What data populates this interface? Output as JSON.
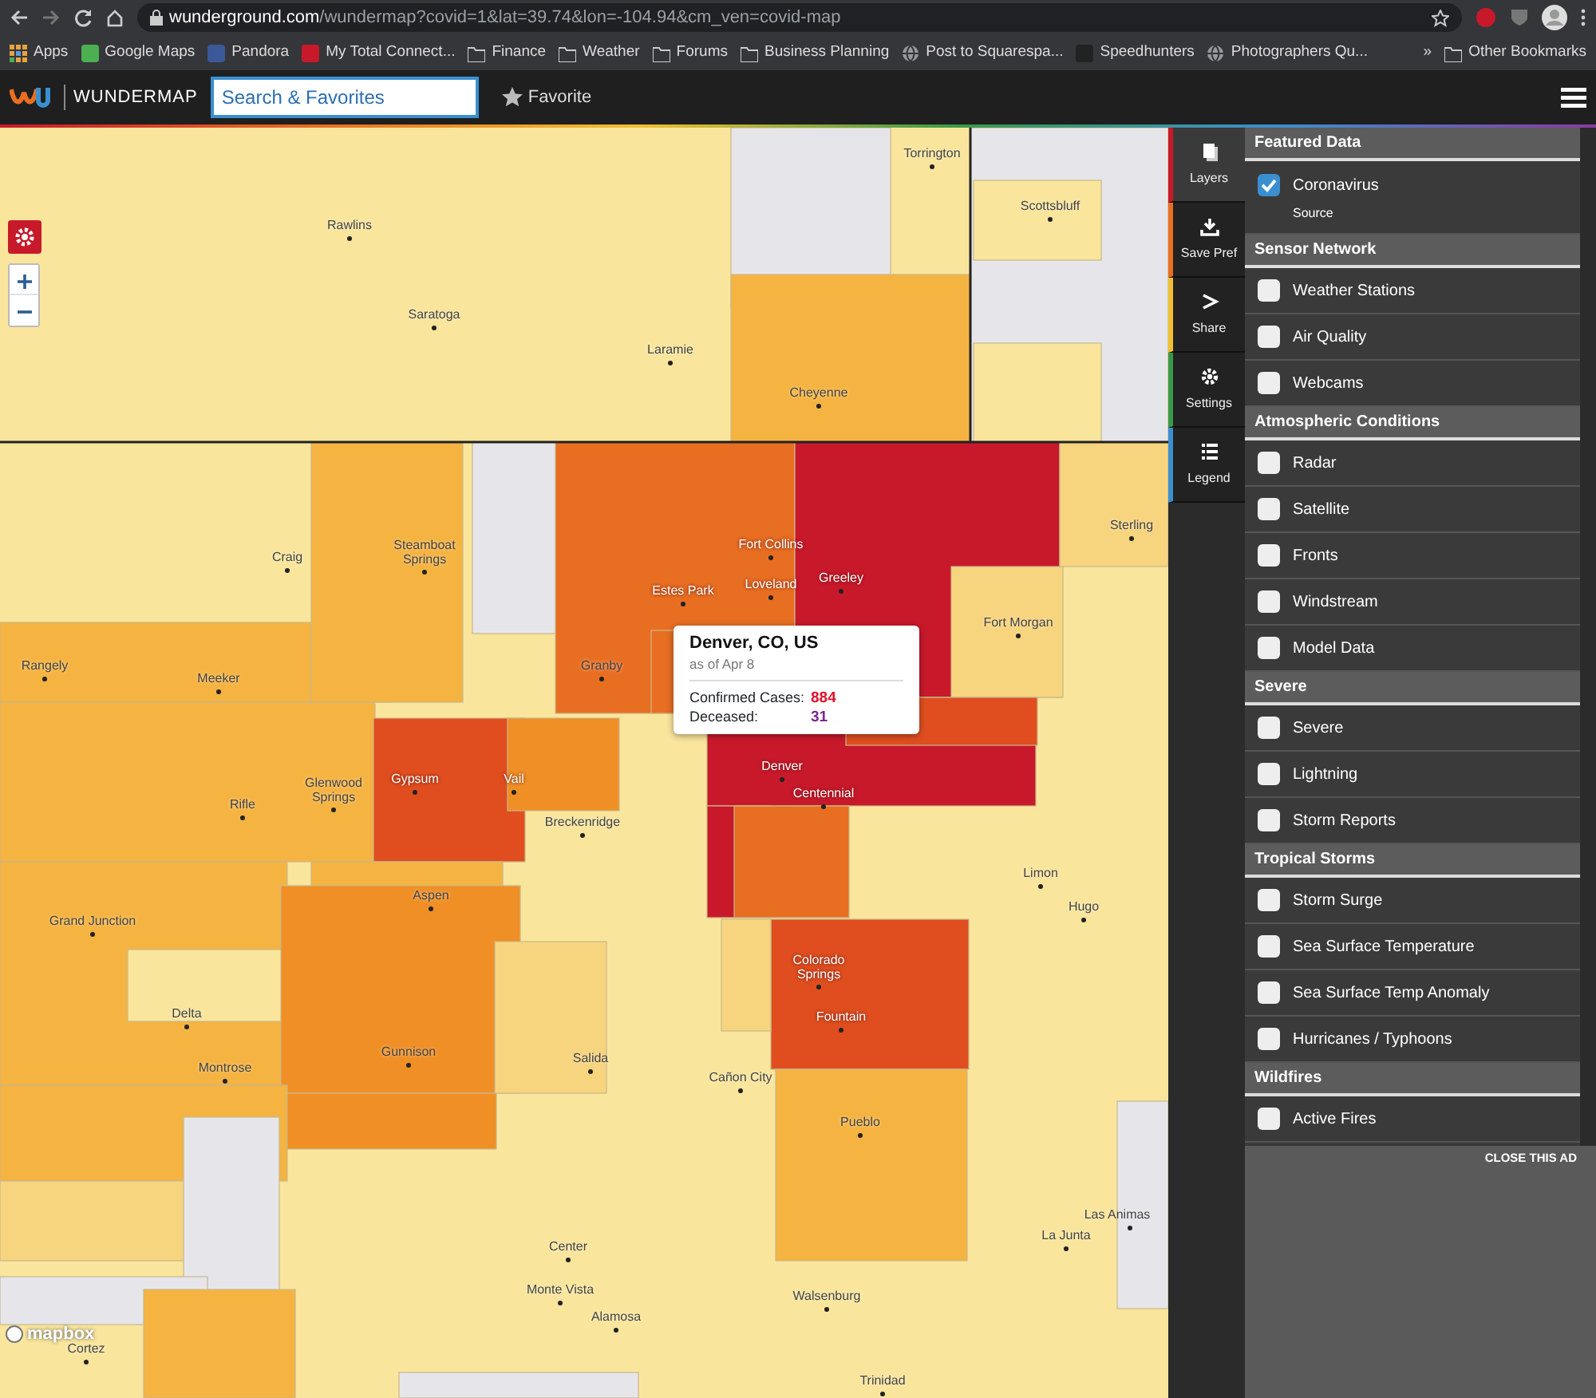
{
  "browser": {
    "url": "**wunderground.com**/wundermap?covid=1&lat=39.74&lon=-104.94&cm_ven=covid-map",
    "bookmarks": [
      {
        "label": "Apps",
        "kind": "grid"
      },
      {
        "label": "Google Maps",
        "kind": "site"
      },
      {
        "label": "Pandora",
        "kind": "site"
      },
      {
        "label": "My Total Connect...",
        "kind": "site"
      },
      {
        "label": "Finance",
        "kind": "folder"
      },
      {
        "label": "Weather",
        "kind": "folder"
      },
      {
        "label": "Forums",
        "kind": "folder"
      },
      {
        "label": "Business Planning",
        "kind": "folder"
      },
      {
        "label": "Post to Squarespa...",
        "kind": "globe"
      },
      {
        "label": "Speedhunters",
        "kind": "site"
      },
      {
        "label": "Photographers Qu...",
        "kind": "globe"
      }
    ],
    "more": "»",
    "other": "Other Bookmarks"
  },
  "app_bar": {
    "brand": "WUNDERMAP",
    "search": {
      "placeholder": "Search & Favorites"
    },
    "favorite": "Favorite"
  },
  "map": {
    "places": [
      "Torrington",
      "Rawlins",
      "Scottsbluff",
      "Saratoga",
      "Laramie",
      "Cheyenne",
      "Sterling",
      "Craig",
      "Steamboat Springs",
      "Fort Collins",
      "Greeley",
      "Estes Park",
      "Loveland",
      "Fort Morgan",
      "Rangely",
      "Meeker",
      "Granby",
      "Denver",
      "Gypsum",
      "Vail",
      "Glenwood Springs",
      "Rifle",
      "Centennial",
      "Breckenridge",
      "Limon",
      "Aspen",
      "Hugo",
      "Grand Junction",
      "Colorado Springs",
      "Delta",
      "Fountain",
      "Gunnison",
      "Salida",
      "Montrose",
      "Cañon City",
      "Pueblo",
      "Las Animas",
      "La Junta",
      "Center",
      "Walsenburg",
      "Monte Vista",
      "Alamosa",
      "Cortez",
      "Trinidad"
    ],
    "popup": {
      "title": "Denver, CO, US",
      "date": "as of Apr 8",
      "rows": [
        {
          "label": "Confirmed Cases:",
          "value": "884",
          "kind": "cases"
        },
        {
          "label": "Deceased:",
          "value": "31",
          "kind": "deaths"
        }
      ]
    },
    "attribution": "mapbox"
  },
  "side_tabs": [
    {
      "label": "Layers",
      "selected": true,
      "color": "#c8192b"
    },
    {
      "label": "Save Pref",
      "selected": false,
      "color": "#e86e22"
    },
    {
      "label": "Share",
      "selected": false,
      "color": "#f0c030"
    },
    {
      "label": "Settings",
      "selected": false,
      "color": "#3a9a48"
    },
    {
      "label": "Legend",
      "selected": false,
      "color": "#3a8fd0"
    }
  ],
  "layers": [
    {
      "title": "Featured Data",
      "items": [
        {
          "label": "Coronavirus",
          "checked": true,
          "sublabel": "Source"
        }
      ]
    },
    {
      "title": "Sensor Network",
      "items": [
        {
          "label": "Weather Stations",
          "checked": false
        },
        {
          "label": "Air Quality",
          "checked": false
        },
        {
          "label": "Webcams",
          "checked": false
        }
      ]
    },
    {
      "title": "Atmospheric Conditions",
      "items": [
        {
          "label": "Radar",
          "checked": false
        },
        {
          "label": "Satellite",
          "checked": false
        },
        {
          "label": "Fronts",
          "checked": false
        },
        {
          "label": "Windstream",
          "checked": false
        },
        {
          "label": "Model Data",
          "checked": false
        }
      ]
    },
    {
      "title": "Severe",
      "items": [
        {
          "label": "Severe",
          "checked": false
        },
        {
          "label": "Lightning",
          "checked": false
        },
        {
          "label": "Storm Reports",
          "checked": false
        }
      ]
    },
    {
      "title": "Tropical Storms",
      "items": [
        {
          "label": "Storm Surge",
          "checked": false
        },
        {
          "label": "Sea Surface Temperature",
          "checked": false
        },
        {
          "label": "Sea Surface Temp Anomaly",
          "checked": false
        },
        {
          "label": "Hurricanes / Typhoons",
          "checked": false
        }
      ]
    },
    {
      "title": "Wildfires",
      "items": [
        {
          "label": "Active Fires",
          "checked": false
        }
      ]
    }
  ],
  "ad": {
    "close": "CLOSE THIS AD"
  }
}
